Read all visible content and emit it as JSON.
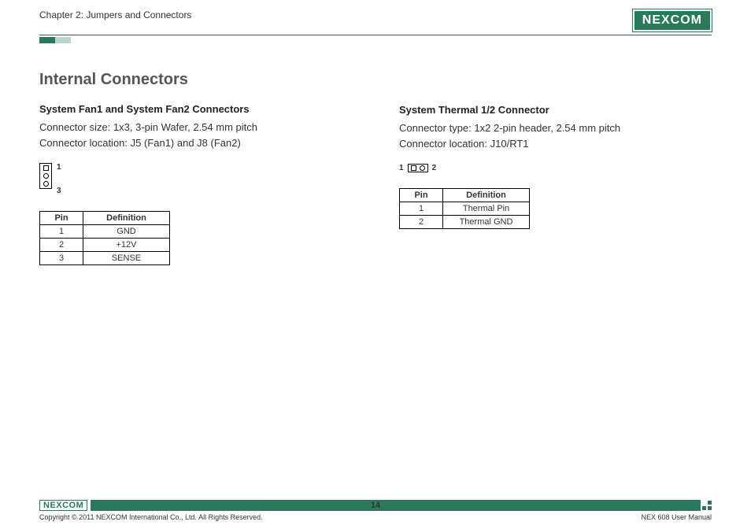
{
  "header": {
    "chapter": "Chapter 2: Jumpers and Connectors",
    "brand": "NEXCOM"
  },
  "section_title": "Internal Connectors",
  "left": {
    "title": "System Fan1 and System Fan2 Connectors",
    "line1": "Connector size: 1x3, 3-pin Wafer, 2.54 mm pitch",
    "line2": "Connector location: J5 (Fan1) and J8 (Fan2)",
    "pin_label_top": "1",
    "pin_label_bot": "3",
    "table": {
      "h1": "Pin",
      "h2": "Definition",
      "rows": [
        {
          "pin": "1",
          "def": "GND"
        },
        {
          "pin": "2",
          "def": "+12V"
        },
        {
          "pin": "3",
          "def": "SENSE"
        }
      ]
    }
  },
  "right": {
    "title": "System Thermal 1/2 Connector",
    "line1": "Connector type: 1x2 2-pin header, 2.54 mm pitch",
    "line2": "Connector location: J10/RT1",
    "pin_label_left": "1",
    "pin_label_right": "2",
    "table": {
      "h1": "Pin",
      "h2": "Definition",
      "rows": [
        {
          "pin": "1",
          "def": "Thermal Pin"
        },
        {
          "pin": "2",
          "def": "Thermal GND"
        }
      ]
    }
  },
  "footer": {
    "brand": "NEXCOM",
    "copyright": "Copyright © 2011 NEXCOM International Co., Ltd. All Rights Reserved.",
    "page": "14",
    "doc": "NEX 608 User Manual"
  }
}
